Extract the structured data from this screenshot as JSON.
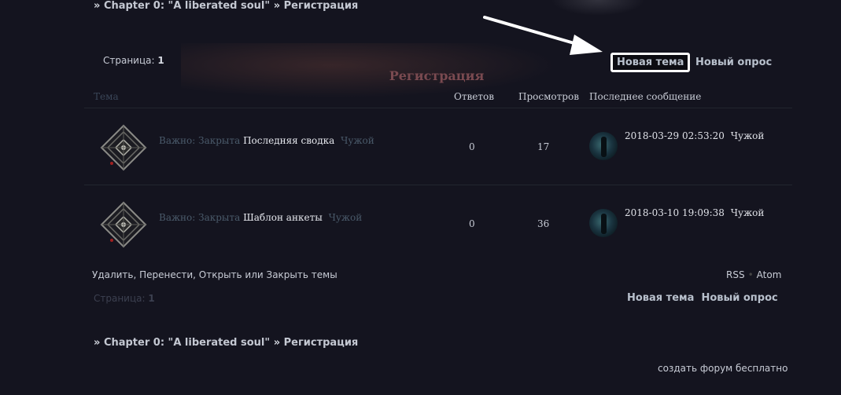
{
  "breadcrumb": {
    "sep": "»",
    "forum": "Chapter 0: \"A liberated soul\"",
    "subforum": "Регистрация"
  },
  "pager": {
    "label": "Страница:",
    "current": "1"
  },
  "actions": {
    "new_topic": "Новая тема",
    "new_poll": "Новый опрос"
  },
  "forum_title": "Регистрация",
  "table": {
    "headers": {
      "topic": "Тема",
      "replies": "Ответов",
      "views": "Просмотров",
      "last_post": "Последнее сообщение"
    },
    "rows": [
      {
        "prefix": "Важно: Закрыта",
        "title": "Последняя сводка",
        "author": "Чужой",
        "replies": "0",
        "views": "17",
        "last_date": "2018-03-29 02:53:20",
        "last_author": "Чужой"
      },
      {
        "prefix": "Важно: Закрыта",
        "title": "Шаблон анкеты",
        "author": "Чужой",
        "replies": "0",
        "views": "36",
        "last_date": "2018-03-10 19:09:38",
        "last_author": "Чужой"
      }
    ]
  },
  "moderation": "Удалить, Перенести, Открыть или Закрыть темы",
  "feeds": {
    "rss": "RSS",
    "sep": "•",
    "atom": "Atom"
  },
  "footer": {
    "create_forum": "создать форум бесплатно"
  },
  "icons": {
    "topic_icon": "diamond-emblem-icon",
    "arrow": "annotation-arrow"
  },
  "colors": {
    "background": "#14141f",
    "forum_title": "#7a4a50",
    "highlight_border": "#ffffff"
  }
}
